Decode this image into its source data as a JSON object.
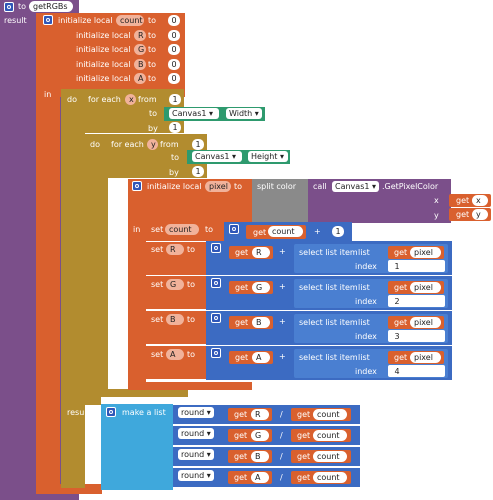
{
  "proc": {
    "to": "to",
    "name": "getRGBs",
    "result": "result"
  },
  "init": {
    "label": "initialize local",
    "to": "to",
    "vars": [
      {
        "name": "count",
        "value": "0"
      },
      {
        "name": "R",
        "value": "0"
      },
      {
        "name": "G",
        "value": "0"
      },
      {
        "name": "B",
        "value": "0"
      },
      {
        "name": "A",
        "value": "0"
      }
    ],
    "in": "in"
  },
  "loop1": {
    "do": "do",
    "for_each": "for each",
    "var": "x",
    "from": "from",
    "from_val": "1",
    "to": "to",
    "comp": "Canvas1",
    "prop": "Width",
    "by": "by",
    "by_val": "1"
  },
  "loop2": {
    "do": "do",
    "for_each": "for each",
    "var": "y",
    "from": "from",
    "from_val": "1",
    "to": "to",
    "comp": "Canvas1",
    "prop": "Height",
    "by": "by",
    "by_val": "1"
  },
  "pixel": {
    "do": "do",
    "init_label": "initialize local",
    "name": "pixel",
    "to": "to",
    "split": "split color",
    "call": "call",
    "comp": "Canvas1",
    "method": ".GetPixelColor",
    "x_label": "x",
    "y_label": "y",
    "get": "get",
    "x": "x",
    "y": "y",
    "in": "in"
  },
  "set_count": {
    "set": "set",
    "var": "count",
    "to": "to",
    "get": "get",
    "plus": "+",
    "one": "1"
  },
  "sets": [
    {
      "var": "R",
      "index": "1"
    },
    {
      "var": "G",
      "index": "2"
    },
    {
      "var": "B",
      "index": "3"
    },
    {
      "var": "A",
      "index": "4"
    }
  ],
  "set_common": {
    "set": "set",
    "to": "to",
    "get": "get",
    "plus": "+",
    "select": "select list item",
    "list": "list",
    "pixel": "pixel",
    "index": "index"
  },
  "result": {
    "label": "result",
    "make": "make a list",
    "round": "round",
    "get": "get",
    "div": "/",
    "count": "count",
    "vars": [
      "R",
      "G",
      "B",
      "A"
    ]
  }
}
